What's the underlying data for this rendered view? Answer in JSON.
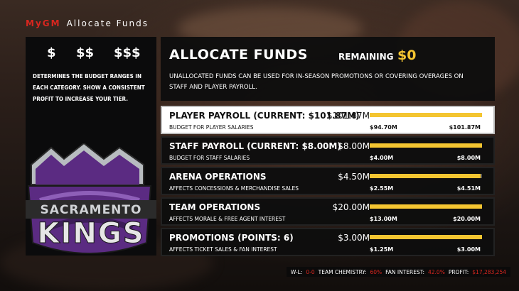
{
  "topbar": {
    "brand": "MyGM",
    "title": "Allocate Funds"
  },
  "left_panel": {
    "tiers": [
      "$",
      "$$",
      "$$$"
    ],
    "description": "Determines the budget ranges in each category. Show a consistent profit to increase your tier."
  },
  "logo": {
    "line1": "SACRAMENTO",
    "line2": "KINGS",
    "colors": {
      "purple": "#5b2b82",
      "silver": "#9aa0a6"
    }
  },
  "header": {
    "title": "ALLOCATE FUNDS",
    "remaining_label": "REMAINING",
    "remaining_value": "$0",
    "description": "Unallocated funds can be used for in-season promotions or covering overages on staff and player payroll."
  },
  "categories": [
    {
      "name": "PLAYER PAYROLL (CURRENT: $101.87M)",
      "sub": "Budget for player salaries",
      "value": "$101.87M",
      "min": "$94.70M",
      "max": "$101.87M",
      "fill": 1.0,
      "active": true
    },
    {
      "name": "STAFF PAYROLL (CURRENT: $8.00M)",
      "sub": "Budget for staff salaries",
      "value": "$8.00M",
      "min": "$4.00M",
      "max": "$8.00M",
      "fill": 1.0,
      "active": false
    },
    {
      "name": "ARENA OPERATIONS",
      "sub": "Affects concessions & merchandise sales",
      "value": "$4.50M",
      "min": "$2.55M",
      "max": "$4.51M",
      "fill": 0.99,
      "active": false
    },
    {
      "name": "TEAM OPERATIONS",
      "sub": "Affects morale & free agent interest",
      "value": "$20.00M",
      "min": "$13.00M",
      "max": "$20.00M",
      "fill": 1.0,
      "active": false
    },
    {
      "name": "PROMOTIONS (POINTS: 6)",
      "sub": "Affects ticket sales & fan interest",
      "value": "$3.00M",
      "min": "$1.25M",
      "max": "$3.00M",
      "fill": 1.0,
      "active": false
    }
  ],
  "footer": {
    "wl_label": "W-L:",
    "wl_value": "0-0",
    "chem_label": "TEAM CHEMISTRY:",
    "chem_value": "60%",
    "fan_label": "FAN INTEREST:",
    "fan_value": "42.0%",
    "profit_label": "PROFIT:",
    "profit_value": "$17,283,254"
  },
  "colors": {
    "accent": "#f4c531",
    "brand_red": "#d8261f",
    "panel": "#0e0e0e"
  }
}
